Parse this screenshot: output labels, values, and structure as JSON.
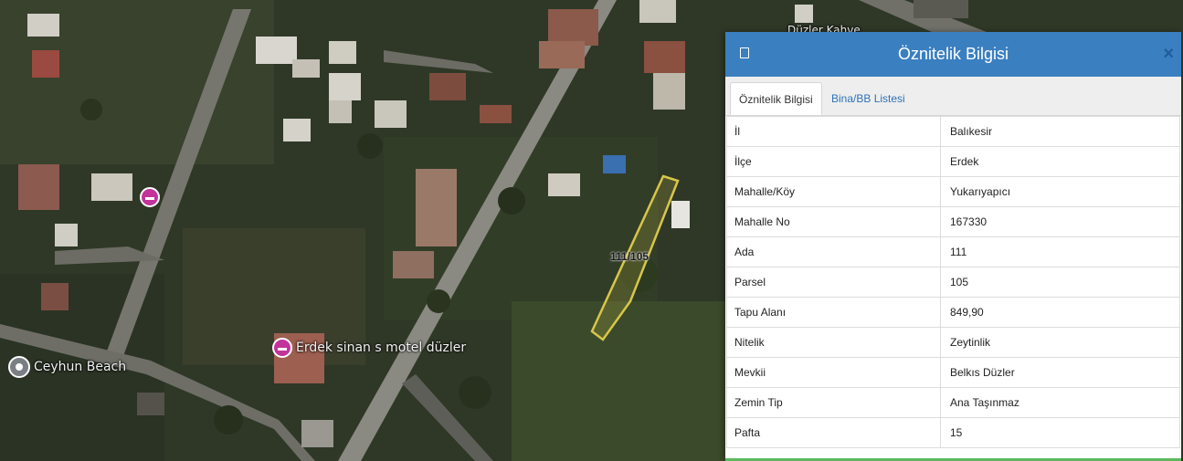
{
  "map": {
    "parcel_label": "111/105",
    "poi_hotel_label": "Erdek sinan s motel düzler",
    "poi_beach_label": "Ceyhun Beach",
    "top_partial_label": "Düzler Kahve"
  },
  "panel": {
    "title": "Öznitelik Bilgisi",
    "close_symbol": "×",
    "tabs": [
      {
        "label": "Öznitelik Bilgisi",
        "active": true
      },
      {
        "label": "Bina/BB Listesi",
        "active": false
      }
    ],
    "rows": [
      {
        "key": "İl",
        "value": "Balıkesir"
      },
      {
        "key": "İlçe",
        "value": "Erdek"
      },
      {
        "key": "Mahalle/Köy",
        "value": "Yukarıyapıcı"
      },
      {
        "key": "Mahalle No",
        "value": "167330"
      },
      {
        "key": "Ada",
        "value": "111"
      },
      {
        "key": "Parsel",
        "value": "105"
      },
      {
        "key": "Tapu Alanı",
        "value": "849,90"
      },
      {
        "key": "Nitelik",
        "value": "Zeytinlik"
      },
      {
        "key": "Mevkii",
        "value": "Belkıs Düzler"
      },
      {
        "key": "Zemin Tip",
        "value": "Ana Taşınmaz"
      },
      {
        "key": "Pafta",
        "value": "15"
      }
    ]
  },
  "colors": {
    "header": "#3a7fc0",
    "tab_link": "#2f72b6",
    "parcel_outline": "#d8c64a",
    "hotel_poi": "#c2339b",
    "bottom_bar": "#5cb85c"
  },
  "icons": {
    "minimize": "window-minimize-icon",
    "close": "close-icon",
    "hotel": "hotel-icon",
    "beach": "place-pin-icon"
  }
}
